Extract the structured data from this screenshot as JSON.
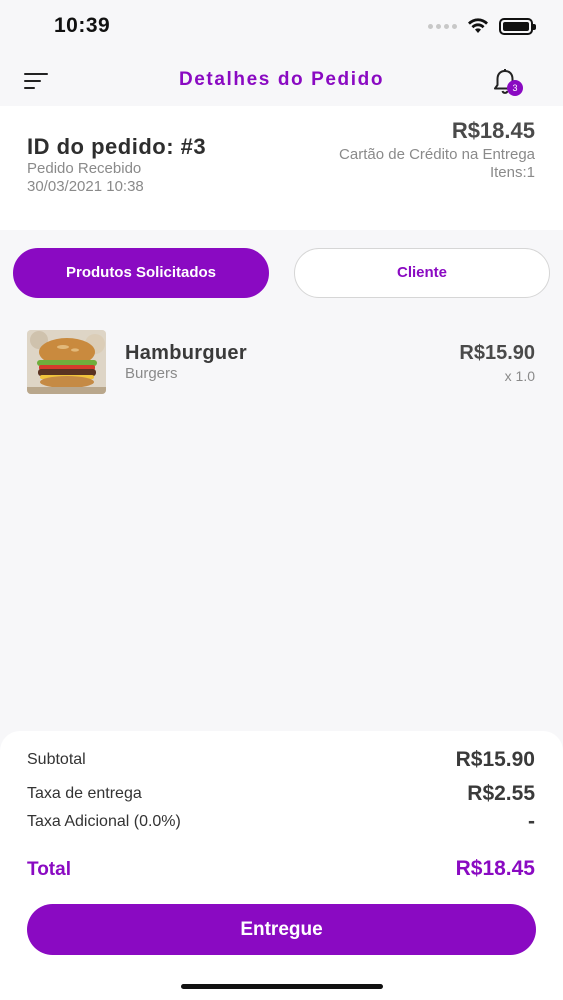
{
  "status_bar": {
    "time": "10:39"
  },
  "header": {
    "title": "Detalhes do Pedido",
    "notification_count": "3"
  },
  "order": {
    "id_label": "ID do pedido: #3",
    "status": "Pedido Recebido",
    "date": "30/03/2021 10:38",
    "total": "R$18.45",
    "payment_method": "Cartão de Crédito na Entrega",
    "items": "Itens:1"
  },
  "tabs": [
    {
      "label": "Produtos Solicitados",
      "active": true
    },
    {
      "label": "Cliente",
      "active": false
    }
  ],
  "products": [
    {
      "name": "Hamburguer",
      "category": "Burgers",
      "price": "R$15.90",
      "quantity": "x 1.0",
      "image": "burger-photo"
    }
  ],
  "summary": {
    "subtotal_label": "Subtotal",
    "subtotal_value": "R$15.90",
    "delivery_label": "Taxa de entrega",
    "delivery_value": "R$2.55",
    "additional_label": "Taxa Adicional (0.0%)",
    "additional_value": "-",
    "total_label": "Total",
    "total_value": "R$18.45"
  },
  "actions": {
    "deliver_label": "Entregue"
  },
  "colors": {
    "accent": "#8a0ac2",
    "background": "#f7f7f9"
  }
}
